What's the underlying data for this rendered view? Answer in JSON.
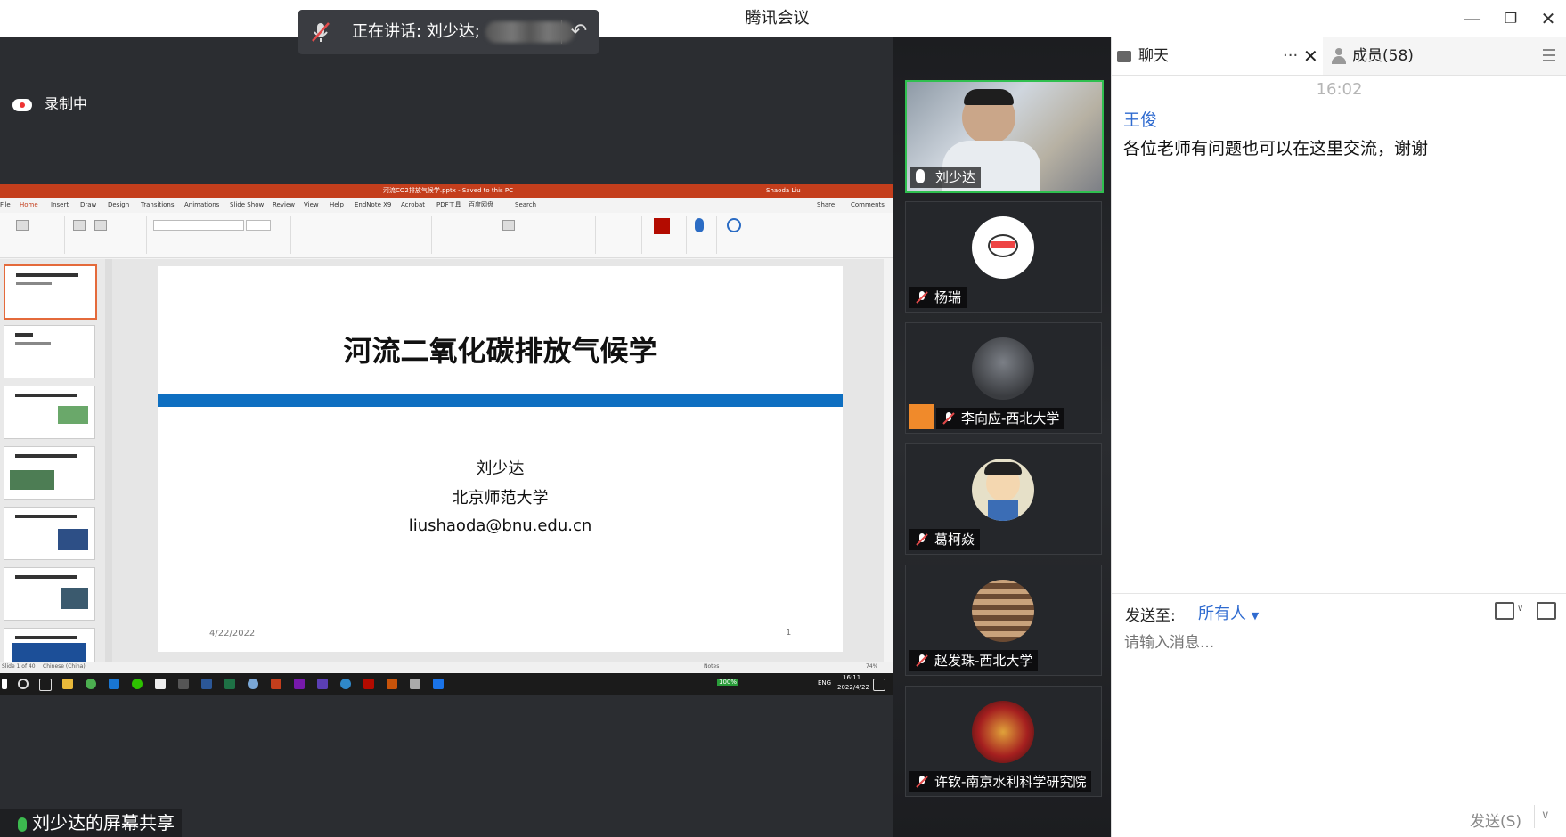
{
  "window": {
    "title": "腾讯会议",
    "minimize_icon": "minimize-icon",
    "restore_icon": "restore-icon",
    "close_icon": "close-icon"
  },
  "speaker_bar": {
    "text": "正在讲话: 刘少达;"
  },
  "recording": {
    "label": "录制中"
  },
  "shared_screen": {
    "file_title": "河流CO2排放气候学.pptx - Saved to this PC",
    "user": "Shaoda Liu",
    "ribbon_tabs": [
      "File",
      "Home",
      "Insert",
      "Draw",
      "Design",
      "Transitions",
      "Animations",
      "Slide Show",
      "Review",
      "View",
      "Help",
      "EndNote X9",
      "Acrobat",
      "PDF工具",
      "百度网盘",
      "Search"
    ],
    "share_button": "Share",
    "comments_button": "Comments",
    "slide": {
      "title": "河流二氧化碳排放气候学",
      "author": "刘少达",
      "institution": "北京师范大学",
      "email": "liushaoda@bnu.edu.cn",
      "date": "4/22/2022",
      "page": "1"
    },
    "statusbar": {
      "slide_of": "Slide 1 of 40",
      "language": "Chinese (China)",
      "notes": "Notes",
      "zoom": "74%"
    },
    "taskbar": {
      "battery": "100%",
      "lang": "ENG",
      "time": "16:11",
      "date": "2022/4/22"
    }
  },
  "sharer_label": "刘少达的屏幕共享",
  "participants": [
    {
      "name": "刘少达",
      "status": "speaking"
    },
    {
      "name": "杨瑞",
      "status": "muted"
    },
    {
      "name": "李向应-西北大学",
      "status": "muted"
    },
    {
      "name": "葛柯焱",
      "status": "muted"
    },
    {
      "name": "赵发珠-西北大学",
      "status": "muted"
    },
    {
      "name": "许钦-南京水利科学研究院",
      "status": "muted"
    }
  ],
  "panel": {
    "chat_tab": "聊天",
    "members_tab": "成员(58)",
    "chat": {
      "time": "16:02",
      "sender": "王俊",
      "message": "各位老师有问题也可以在这里交流，谢谢"
    },
    "send_to_label": "发送至:",
    "send_to_value": "所有人",
    "input_placeholder": "请输入消息...",
    "send_button": "发送(S)"
  }
}
